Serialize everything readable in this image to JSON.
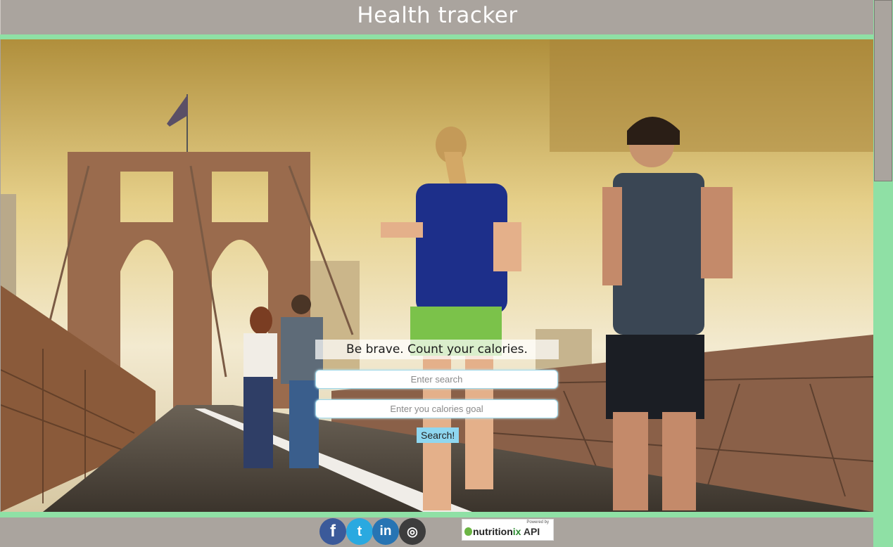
{
  "header": {
    "title": "Health tracker"
  },
  "search": {
    "tagline": "Be brave. Count your calories.",
    "query_placeholder": "Enter search",
    "goal_placeholder": "Enter you calories goal",
    "button_label": "Search!"
  },
  "footer": {
    "social": [
      {
        "name": "facebook",
        "glyph": "f"
      },
      {
        "name": "twitter",
        "glyph": "t"
      },
      {
        "name": "linkedin",
        "glyph": "in"
      },
      {
        "name": "instagram",
        "glyph": "◎"
      }
    ],
    "powered_by": "Powered by",
    "brand_prefix": "nutrition",
    "brand_suffix": "ix",
    "brand_api": "API"
  },
  "colors": {
    "accent_green": "#8fe0a5",
    "bar_gray": "#aaa49e",
    "button_blue": "#8fd7f0"
  }
}
